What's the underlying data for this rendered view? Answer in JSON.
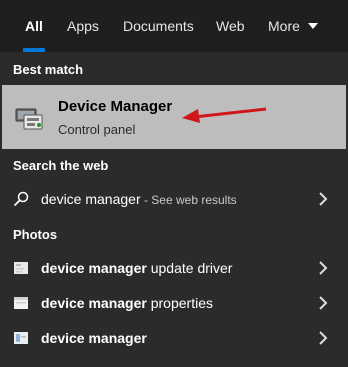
{
  "tabs": [
    {
      "label": "All",
      "active": true
    },
    {
      "label": "Apps"
    },
    {
      "label": "Documents"
    },
    {
      "label": "Web"
    },
    {
      "label": "More"
    }
  ],
  "best_match": {
    "heading": "Best match",
    "title": "Device Manager",
    "subtitle": "Control panel"
  },
  "search_web": {
    "heading": "Search the web",
    "query": "device manager",
    "hint": " - See web results"
  },
  "photos": {
    "heading": "Photos",
    "items": [
      {
        "bold": "device manager",
        "rest": " update driver"
      },
      {
        "bold": "device manager",
        "rest": " properties"
      },
      {
        "bold": "device manager",
        "rest": ""
      }
    ]
  },
  "colors": {
    "tab_bar": "#1f1f1f",
    "background": "#2b2b2b",
    "highlight": "#bdbdbd",
    "accent": "#0078d7",
    "arrow": "#d0161b"
  }
}
